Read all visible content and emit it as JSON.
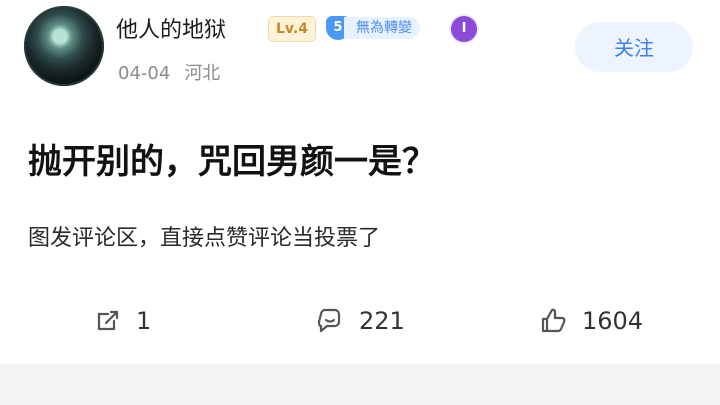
{
  "post": {
    "username": "他人的地狱",
    "level_badge": "Lv.4",
    "rank_badge": {
      "number": "5",
      "label": "無為轉變"
    },
    "date": "04-04",
    "location": "河北",
    "follow_label": "关注",
    "title": "抛开别的，咒回男颜一是？",
    "subtitle": "图发评论区，直接点赞评论当投票了"
  },
  "actions": {
    "share_count": "1",
    "comment_count": "221",
    "like_count": "1604"
  },
  "colors": {
    "accent": "#3b7ef5",
    "follow_bg": "#eef4ff",
    "meta_text": "#8c8c8c"
  }
}
